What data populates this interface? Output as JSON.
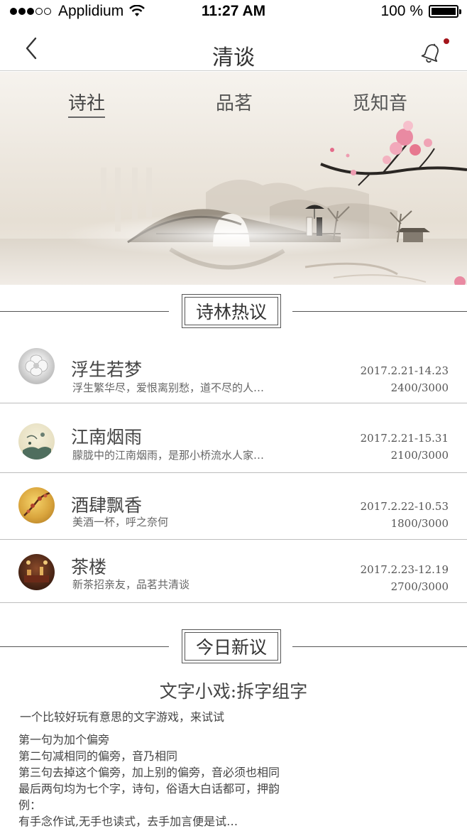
{
  "status_bar": {
    "carrier": "Applidium",
    "time": "11:27 AM",
    "battery": "100 %"
  },
  "nav": {
    "title": "清谈"
  },
  "tabs": [
    {
      "label": "诗社",
      "active": true
    },
    {
      "label": "品茗",
      "active": false
    },
    {
      "label": "觅知音",
      "active": false
    }
  ],
  "sections": {
    "hot": "诗林热议",
    "today": "今日新议"
  },
  "topics": [
    {
      "title": "浮生若梦",
      "subtitle": "浮生繁华尽，爱恨离别愁，道不尽的人…",
      "date": "2017.2.21-14.23",
      "count": "2400/3000",
      "avatar_icon": "white-flower-avatar"
    },
    {
      "title": "江南烟雨",
      "subtitle": "朦胧中的江南烟雨，是那小桥流水人家…",
      "date": "2017.2.21-15.31",
      "count": "2100/3000",
      "avatar_icon": "ink-painting-avatar"
    },
    {
      "title": "酒肆飘香",
      "subtitle": "美酒一杯，呼之奈何",
      "date": "2017.2.22-10.53",
      "count": "1800/3000",
      "avatar_icon": "plum-blossom-avatar"
    },
    {
      "title": "茶楼",
      "subtitle": "新茶招亲友，品茗共清谈",
      "date": "2017.2.23-12.19",
      "count": "2700/3000",
      "avatar_icon": "tea-house-avatar"
    }
  ],
  "article": {
    "title": "文字小戏:拆字组字",
    "intro": "一个比较好玩有意思的文字游戏，来试试",
    "lines": [
      "第一句为加个偏旁",
      "第二句减相同的偏旁，音乃相同",
      "第三句去掉这个偏旁，加上别的偏旁，音必须也相同",
      "最后两句均为七个字，诗句，俗语大白话都可，押韵",
      "例：",
      "有手念作试,无手也读式，去手加言便是试…"
    ]
  },
  "colors": {
    "notification_dot": "#a4151b",
    "divider": "#bdbdbd",
    "text": "#444444"
  }
}
